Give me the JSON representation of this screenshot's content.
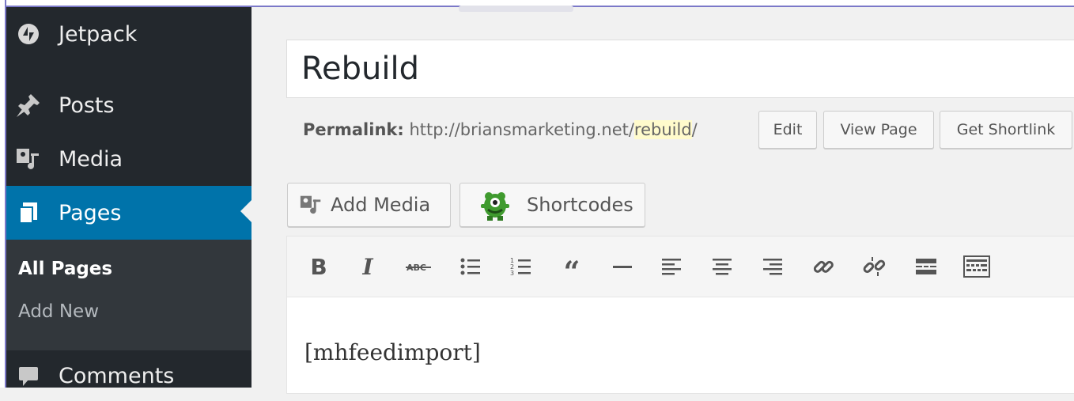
{
  "sidebar": {
    "items": [
      {
        "label": "Jetpack",
        "icon": "jetpack-icon"
      },
      {
        "label": "Posts",
        "icon": "pin-icon"
      },
      {
        "label": "Media",
        "icon": "media-icon"
      },
      {
        "label": "Pages",
        "icon": "pages-icon",
        "active": true
      },
      {
        "label": "Comments",
        "icon": "comment-icon"
      }
    ],
    "submenu": [
      {
        "label": "All Pages",
        "current": true
      },
      {
        "label": "Add New"
      }
    ]
  },
  "editor": {
    "title_value": "Rebuild",
    "permalink_label": "Permalink:",
    "permalink_base": "http://briansmarketing.net/",
    "permalink_slug": "rebuild",
    "permalink_trailing": "/",
    "buttons": {
      "edit": "Edit",
      "view_page": "View Page",
      "get_shortlink": "Get Shortlink"
    },
    "add_media": "Add Media",
    "shortcodes": "Shortcodes",
    "toolbar": [
      "bold",
      "italic",
      "strikethrough",
      "bulleted-list",
      "numbered-list",
      "blockquote",
      "horizontal-line",
      "align-left",
      "align-center",
      "align-right",
      "insert-link",
      "remove-link",
      "read-more",
      "toolbar-toggle"
    ],
    "content": "[mhfeedimport]"
  },
  "colors": {
    "sidebar_bg": "#23282d",
    "submenu_bg": "#32373c",
    "active_bg": "#0073aa",
    "slug_highlight": "#fffbcc"
  }
}
